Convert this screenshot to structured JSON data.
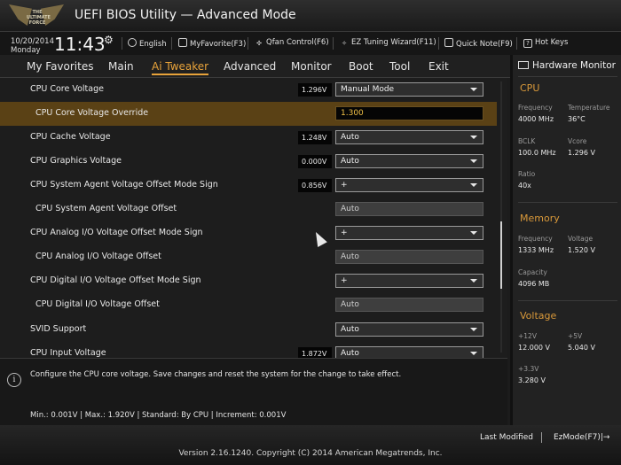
{
  "header": {
    "title": "UEFI BIOS Utility — Advanced Mode",
    "logo_text": "THE ULTIMATE FORCE"
  },
  "infobar": {
    "date": "10/20/2014",
    "day": "Monday",
    "time": "11:43",
    "items": [
      {
        "label": "English",
        "icon": "globe-icon"
      },
      {
        "label": "MyFavorite(F3)",
        "icon": "favorite-icon"
      },
      {
        "label": "Qfan Control(F6)",
        "icon": "fan-icon"
      },
      {
        "label": "EZ Tuning Wizard(F11)",
        "icon": "wizard-icon"
      },
      {
        "label": "Quick Note(F9)",
        "icon": "note-icon"
      },
      {
        "label": "Hot Keys",
        "icon": "help-icon"
      }
    ]
  },
  "menu": {
    "active": "Ai Tweaker",
    "items": [
      "My Favorites",
      "Main",
      "Ai Tweaker",
      "Advanced",
      "Monitor",
      "Boot",
      "Tool",
      "Exit"
    ]
  },
  "settings": [
    {
      "label": "CPU Core Voltage",
      "value": "1.296V",
      "control": "Manual Mode"
    },
    {
      "label": "CPU Core Voltage Override",
      "input": "1.300"
    },
    {
      "label": "CPU Cache Voltage",
      "value": "1.248V",
      "control": "Auto"
    },
    {
      "label": "CPU Graphics Voltage",
      "value": "0.000V",
      "control": "Auto"
    },
    {
      "label": "CPU System Agent Voltage Offset Mode Sign",
      "value": "0.856V",
      "control": "+"
    },
    {
      "label": "CPU System Agent Voltage Offset",
      "control": "Auto"
    },
    {
      "label": "CPU Analog I/O Voltage Offset Mode Sign",
      "control": "+"
    },
    {
      "label": "CPU Analog I/O Voltage Offset",
      "control": "Auto"
    },
    {
      "label": "CPU Digital I/O Voltage Offset Mode Sign",
      "control": "+"
    },
    {
      "label": "CPU Digital I/O Voltage Offset",
      "control": "Auto"
    },
    {
      "label": "SVID Support",
      "control": "Auto"
    },
    {
      "label": "CPU Input Voltage",
      "value": "1.872V",
      "control": "Auto"
    }
  ],
  "help": {
    "text": "Configure the CPU core voltage. Save changes and reset the system for the change to take effect.",
    "limits": "Min.: 0.001V   |   Max.: 1.920V   |   Standard: By CPU   |   Increment: 0.001V"
  },
  "hw_monitor": {
    "title": "Hardware Monitor",
    "cpu": {
      "heading": "CPU",
      "frequency_label": "Frequency",
      "frequency": "4000 MHz",
      "temperature_label": "Temperature",
      "temperature": "36°C",
      "bclk_label": "BCLK",
      "bclk": "100.0 MHz",
      "vcore_label": "Vcore",
      "vcore": "1.296 V",
      "ratio_label": "Ratio",
      "ratio": "40x"
    },
    "memory": {
      "heading": "Memory",
      "frequency_label": "Frequency",
      "frequency": "1333 MHz",
      "voltage_label": "Voltage",
      "voltage": "1.520 V",
      "capacity_label": "Capacity",
      "capacity": "4096 MB"
    },
    "voltage": {
      "heading": "Voltage",
      "v12_label": "+12V",
      "v12": "12.000 V",
      "v5_label": "+5V",
      "v5": "5.040 V",
      "v33_label": "+3.3V",
      "v33": "3.280 V"
    }
  },
  "footer": {
    "last_modified": "Last Modified",
    "ez_mode": "EzMode(F7)|→",
    "version": "Version 2.16.1240. Copyright (C) 2014 American Megatrends, Inc."
  }
}
